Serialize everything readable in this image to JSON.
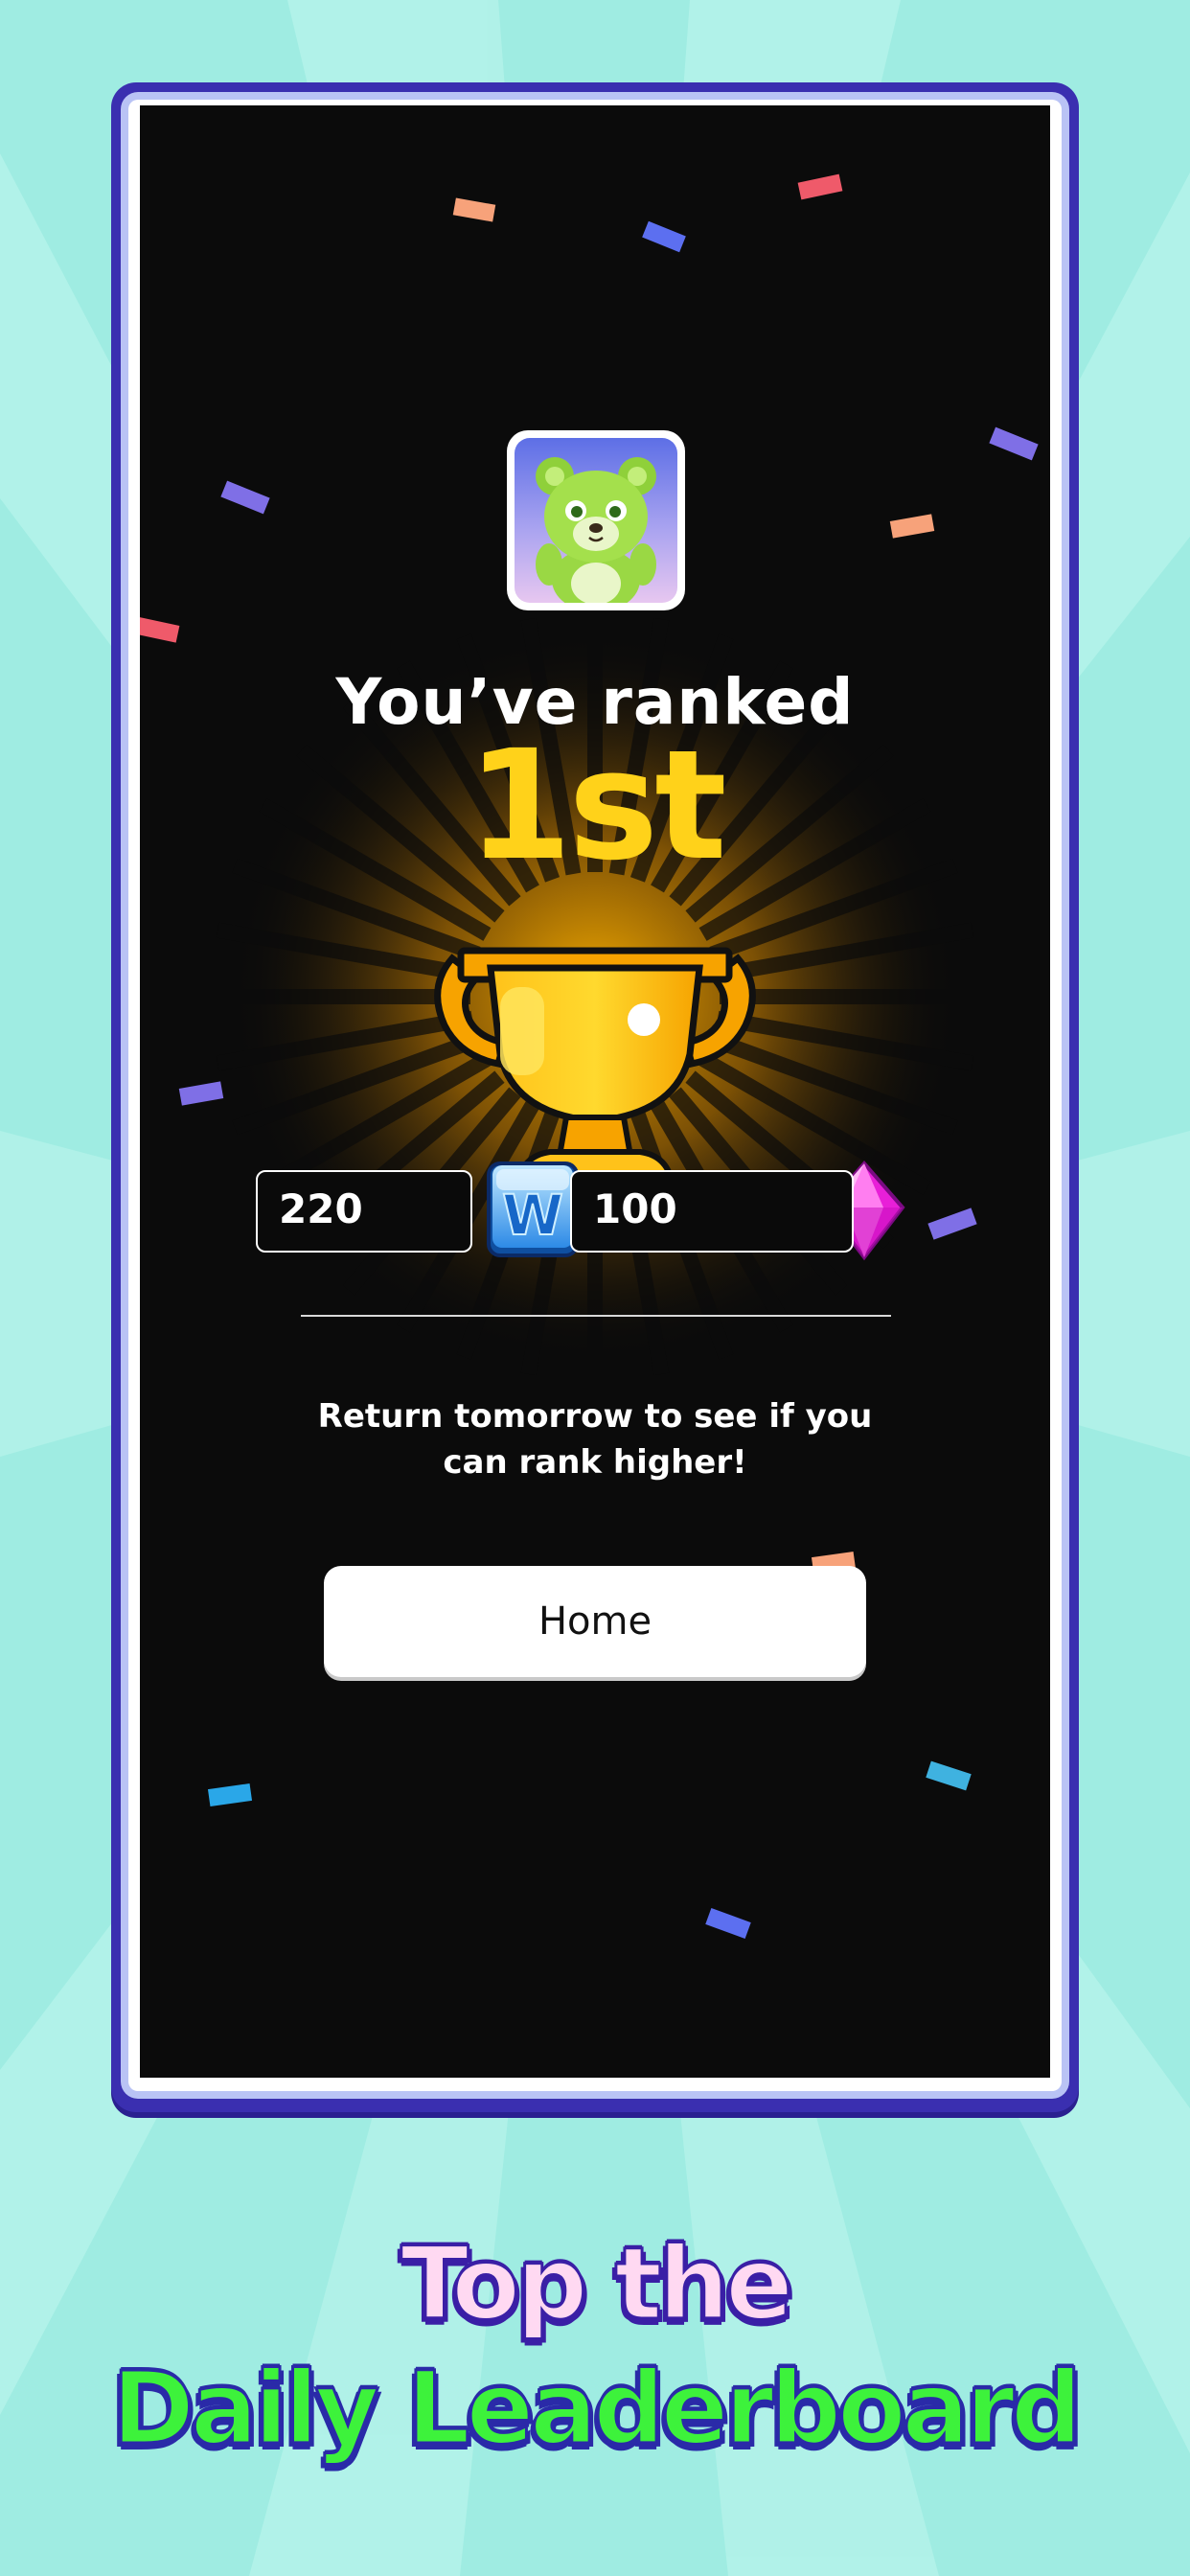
{
  "avatar": {
    "icon": "bear-avatar-icon"
  },
  "result": {
    "title": "You’ve ranked",
    "rank": "1st",
    "trophy_icon": "trophy-icon"
  },
  "rewards": [
    {
      "value": "220",
      "icon": "w-tile-icon"
    },
    {
      "value": "100",
      "icon": "pink-gem-icon"
    }
  ],
  "message": "Return tomorrow to see if you can rank higher!",
  "home_button": {
    "label": "Home"
  },
  "headline": {
    "line1": "Top the",
    "line2": "Daily Leaderboard"
  },
  "colors": {
    "background": "#9fece2",
    "frame": "#3a2fb0",
    "screen": "#0b0b0b",
    "rank_gold": "#ffd21a",
    "headline_pink": "#ffd9f2",
    "headline_green": "#3df23b"
  }
}
